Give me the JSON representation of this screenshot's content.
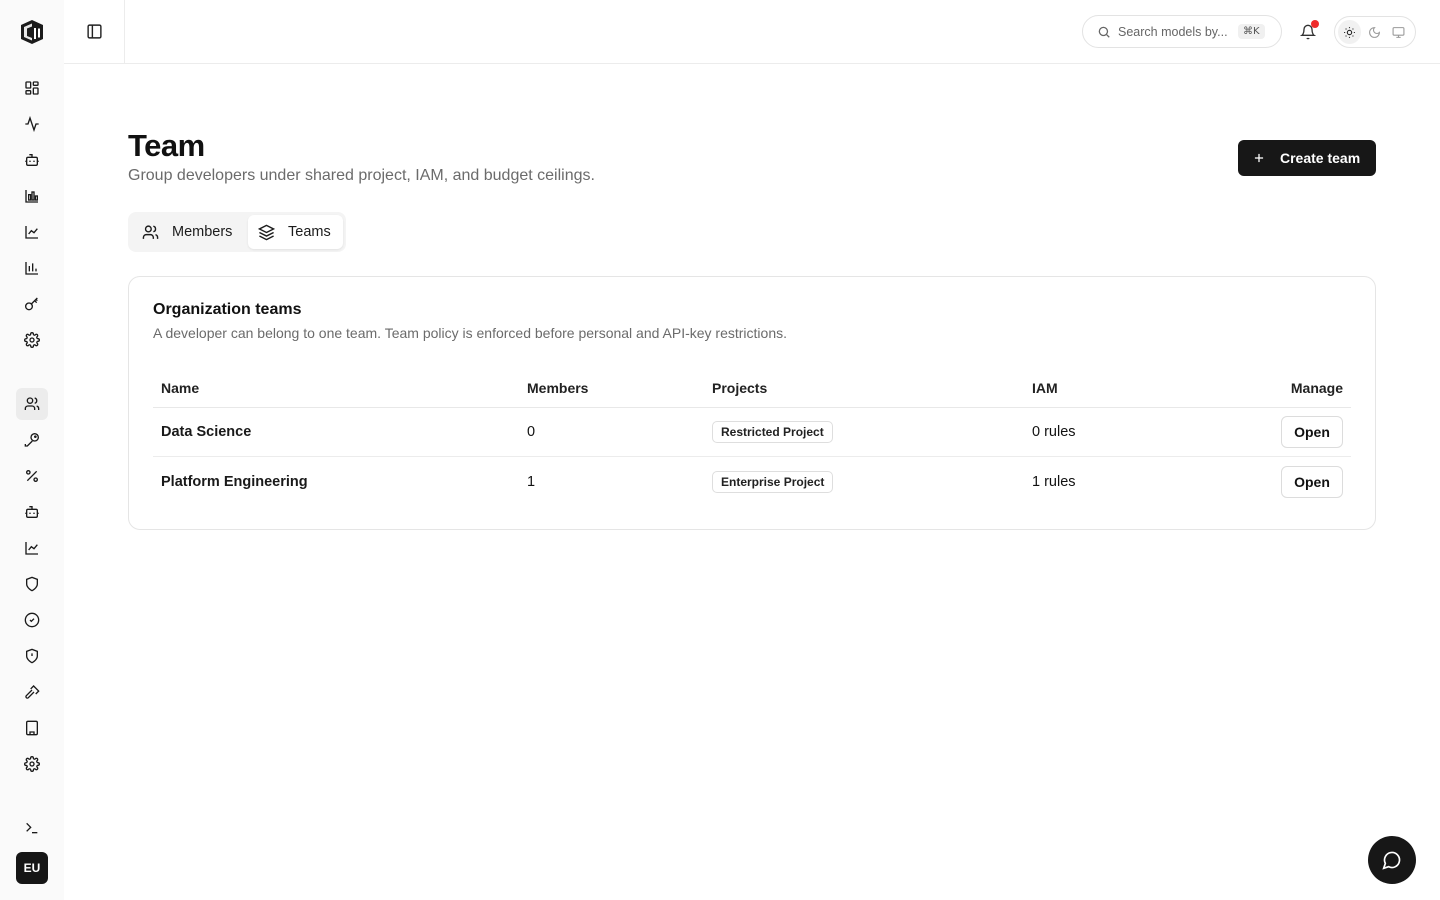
{
  "header": {
    "search_placeholder": "Search models by...",
    "search_shortcut": "⌘K",
    "notification_unread": true,
    "theme_options": [
      "light",
      "dark",
      "system"
    ],
    "theme_selected": "light"
  },
  "sidebar": {
    "logo_icon": "stacked-blocks-logo-icon",
    "items": [
      {
        "icon": "dashboard-icon"
      },
      {
        "icon": "activity-icon"
      },
      {
        "icon": "bot-icon"
      },
      {
        "icon": "bar-chart-icon"
      },
      {
        "icon": "line-chart-icon"
      },
      {
        "icon": "column-chart-icon"
      },
      {
        "icon": "key-icon"
      },
      {
        "icon": "settings-icon"
      },
      {
        "icon": "users-icon",
        "active": true
      },
      {
        "icon": "key-round-icon"
      },
      {
        "icon": "percent-icon"
      },
      {
        "icon": "bot-icon"
      },
      {
        "icon": "line-chart-icon"
      },
      {
        "icon": "shield-icon"
      },
      {
        "icon": "check-circle-icon"
      },
      {
        "icon": "shield-alert-icon"
      },
      {
        "icon": "hammer-icon"
      },
      {
        "icon": "building-icon"
      },
      {
        "icon": "settings-icon"
      },
      {
        "icon": "terminal-icon"
      }
    ],
    "avatar_initials": "EU"
  },
  "page": {
    "title": "Team",
    "subtitle": "Group developers under shared project, IAM, and budget ceilings.",
    "create_button_label": "Create team"
  },
  "tabs": [
    {
      "label": "Members",
      "icon": "users-icon",
      "active": false
    },
    {
      "label": "Teams",
      "icon": "layers-icon",
      "active": true
    }
  ],
  "teams_card": {
    "title": "Organization teams",
    "description": "A developer can belong to one team. Team policy is enforced before personal and API-key restrictions.",
    "columns": {
      "name": "Name",
      "members": "Members",
      "projects": "Projects",
      "iam": "IAM",
      "manage": "Manage"
    },
    "rows": [
      {
        "name": "Data Science",
        "members": "0",
        "project": "Restricted Project",
        "iam": "0 rules",
        "action": "Open"
      },
      {
        "name": "Platform Engineering",
        "members": "1",
        "project": "Enterprise Project",
        "iam": "1 rules",
        "action": "Open"
      }
    ]
  },
  "chat_button_icon": "message-circle-icon"
}
